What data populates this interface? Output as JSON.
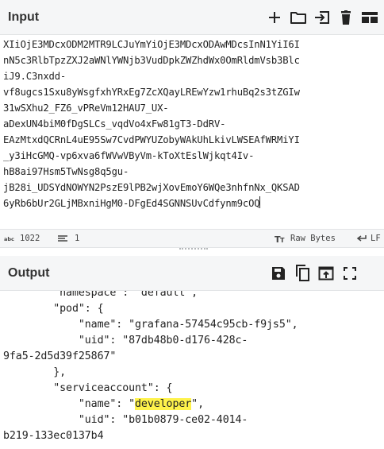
{
  "input": {
    "title": "Input",
    "lines": [
      "XIiOjE3MDcxODM2MTR9LCJuYmYiOjE3MDcxODAwMDcsInN1YiI6I",
      "nN5c3RlbTpzZXJ2aWNlYWNjb3VudDpkZWZhdWx0OmRldmVsb3Blc",
      "iJ9.C3nxdd-",
      "vf8ugcs1Sxu8yWsgfxhYRxEg7ZcXQayLREwYzw1rhuBq2s3tZGIw",
      "31wSXhu2_FZ6_vPReVm12HAU7_UX-",
      "aDexUN4biM0fDgSLCs_vqdVo4xFw81gT3-DdRV-",
      "EAzMtxdQCRnL4uE95Sw7CvdPWYUZobyWAkUhLkivLWSEAfWRMiYI",
      "_y3iHcGMQ-vp6xva6fWVwVByVm-kToXtEslWjkqt4Iv-",
      "hB8ai97Hsm5TwNsg8q5gu-",
      "jB28i_UDSYdNOWYN2PszE9lPB2wjXovEmoY6WQe3nhfnNx_QKSAD",
      "6yRb6bUr2GLjMBxniHgM0-DFgEd4SGNNSUvCdfynm9cOQ"
    ]
  },
  "status": {
    "chars_label": "1022",
    "lines_label": "1",
    "raw_bytes_label": "Raw Bytes",
    "eol_label": "LF"
  },
  "output": {
    "title": "Output",
    "lines": [
      {
        "text": "        \"namespace\": \"default\","
      },
      {
        "text": "        \"pod\": {"
      },
      {
        "text": "            \"name\": \"grafana-57454c95cb-f9js5\","
      },
      {
        "text": "            \"uid\": \"87db48b0-d176-428c-"
      },
      {
        "text": "9fa5-2d5d39f25867\""
      },
      {
        "text": "        },"
      },
      {
        "text": "        \"serviceaccount\": {"
      },
      {
        "pre": "            \"name\": \"",
        "highlight": "developer",
        "post": "\","
      },
      {
        "text": "            \"uid\": \"b01b0879-ce02-4014-"
      },
      {
        "text": "b219-133ec0137b4"
      }
    ]
  },
  "icons": {
    "input": [
      "plus-icon",
      "folder-icon",
      "import-icon",
      "trash-icon",
      "layout-icon"
    ],
    "output": [
      "save-icon",
      "copy-icon",
      "replace-input-icon",
      "maximize-icon"
    ]
  },
  "colors": {
    "header_bg": "#f5f6f7",
    "border": "#e2e4e6",
    "highlight": "#fef24b",
    "icon": "#222222"
  }
}
